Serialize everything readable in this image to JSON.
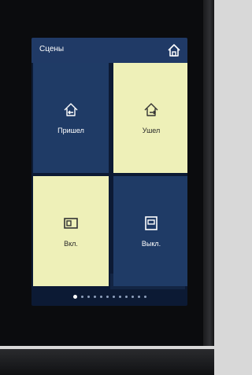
{
  "header": {
    "title": "Сцены",
    "home_icon": "home-icon"
  },
  "tiles": [
    {
      "label": "Пришел",
      "icon": "home-arrive-icon",
      "style": "dark"
    },
    {
      "label": "Ушел",
      "icon": "home-leave-icon",
      "style": "light"
    },
    {
      "label": "Вкл.",
      "icon": "switch-on-icon",
      "style": "light"
    },
    {
      "label": "Выкл.",
      "icon": "switch-off-icon",
      "style": "dark"
    }
  ],
  "pager": {
    "total": 12,
    "current": 1
  },
  "colors": {
    "tile_dark": "#1f3b66",
    "tile_light": "#eef0b8",
    "header": "#203a66",
    "screen_bg": "#0c1a34"
  }
}
